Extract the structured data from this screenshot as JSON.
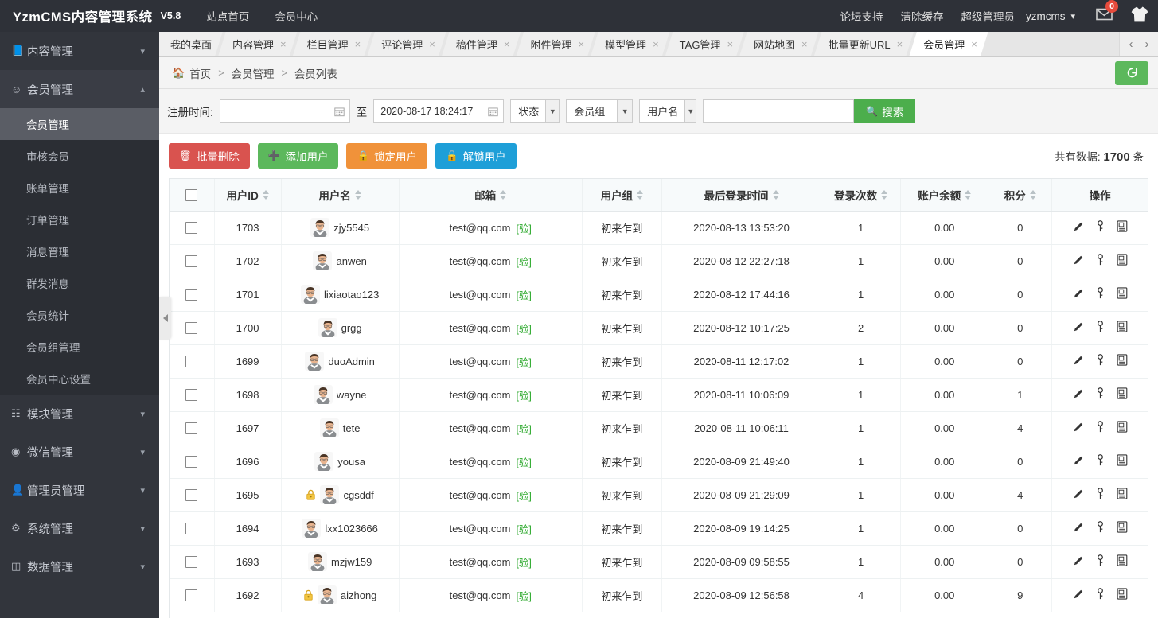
{
  "header": {
    "brand": "YzmCMS内容管理系统",
    "version": "V5.8",
    "nav": [
      {
        "label": "站点首页",
        "name": "site-home-link"
      },
      {
        "label": "会员中心",
        "name": "member-center-link"
      }
    ],
    "right_links": [
      {
        "label": "论坛支持",
        "name": "forum-support-link"
      },
      {
        "label": "清除缓存",
        "name": "clear-cache-link"
      },
      {
        "label": "超级管理员",
        "name": "super-admin-link"
      }
    ],
    "username": "yzmcms",
    "message_badge": "0"
  },
  "sidebar": {
    "groups": [
      {
        "label": "内容管理",
        "icon": "book-icon",
        "open": false,
        "items": []
      },
      {
        "label": "会员管理",
        "icon": "user-outline-icon",
        "open": true,
        "items": [
          {
            "label": "会员管理",
            "active": true
          },
          {
            "label": "审核会员",
            "active": false
          },
          {
            "label": "账单管理",
            "active": false
          },
          {
            "label": "订单管理",
            "active": false
          },
          {
            "label": "消息管理",
            "active": false
          },
          {
            "label": "群发消息",
            "active": false
          },
          {
            "label": "会员统计",
            "active": false
          },
          {
            "label": "会员组管理",
            "active": false
          },
          {
            "label": "会员中心设置",
            "active": false
          }
        ]
      },
      {
        "label": "模块管理",
        "icon": "grid-icon",
        "open": false,
        "items": []
      },
      {
        "label": "微信管理",
        "icon": "wechat-icon",
        "open": false,
        "items": []
      },
      {
        "label": "管理员管理",
        "icon": "user-solid-icon",
        "open": false,
        "items": []
      },
      {
        "label": "系统管理",
        "icon": "gear-icon",
        "open": false,
        "items": []
      },
      {
        "label": "数据管理",
        "icon": "database-icon",
        "open": false,
        "items": []
      }
    ]
  },
  "tabs": [
    {
      "label": "我的桌面",
      "closable": false,
      "active": false
    },
    {
      "label": "内容管理",
      "closable": true,
      "active": false
    },
    {
      "label": "栏目管理",
      "closable": true,
      "active": false
    },
    {
      "label": "评论管理",
      "closable": true,
      "active": false
    },
    {
      "label": "稿件管理",
      "closable": true,
      "active": false
    },
    {
      "label": "附件管理",
      "closable": true,
      "active": false
    },
    {
      "label": "模型管理",
      "closable": true,
      "active": false
    },
    {
      "label": "TAG管理",
      "closable": true,
      "active": false
    },
    {
      "label": "网站地图",
      "closable": true,
      "active": false
    },
    {
      "label": "批量更新URL",
      "closable": true,
      "active": false
    },
    {
      "label": "会员管理",
      "closable": true,
      "active": true
    }
  ],
  "breadcrumb": {
    "home": "首页",
    "level2": "会员管理",
    "level3": "会员列表",
    "sep": ">"
  },
  "filter": {
    "label": "注册时间:",
    "date_from": "",
    "date_from_placeholder": "",
    "between": "至",
    "date_to": "2020-08-17 18:24:17",
    "select_state": "状态",
    "select_group": "会员组",
    "select_field": "用户名",
    "keyword": "",
    "keyword_placeholder": "",
    "search_label": "搜索"
  },
  "toolbar": {
    "batch_delete": "批量删除",
    "add_user": "添加用户",
    "lock_user": "锁定用户",
    "unlock_user": "解锁用户",
    "total_prefix": "共有数据:",
    "total_count": "1700",
    "total_suffix": "条"
  },
  "table": {
    "columns": [
      {
        "label": "",
        "sortable": false,
        "name": "select-all"
      },
      {
        "label": "用户ID",
        "sortable": true
      },
      {
        "label": "用户名",
        "sortable": true
      },
      {
        "label": "邮箱",
        "sortable": true
      },
      {
        "label": "用户组",
        "sortable": true
      },
      {
        "label": "最后登录时间",
        "sortable": true
      },
      {
        "label": "登录次数",
        "sortable": true
      },
      {
        "label": "账户余额",
        "sortable": true
      },
      {
        "label": "积分",
        "sortable": true
      },
      {
        "label": "操作",
        "sortable": false
      }
    ],
    "verified_badge": "[验]",
    "rows": [
      {
        "id": "1703",
        "username": "zjy5545",
        "locked": false,
        "email": "test@qq.com",
        "group": "初来乍到",
        "last_login": "2020-08-13 13:53:20",
        "login_count": "1",
        "balance": "0.00",
        "points": "0"
      },
      {
        "id": "1702",
        "username": "anwen",
        "locked": false,
        "email": "test@qq.com",
        "group": "初来乍到",
        "last_login": "2020-08-12 22:27:18",
        "login_count": "1",
        "balance": "0.00",
        "points": "0"
      },
      {
        "id": "1701",
        "username": "lixiaotao123",
        "locked": false,
        "email": "test@qq.com",
        "group": "初来乍到",
        "last_login": "2020-08-12 17:44:16",
        "login_count": "1",
        "balance": "0.00",
        "points": "0"
      },
      {
        "id": "1700",
        "username": "grgg",
        "locked": false,
        "email": "test@qq.com",
        "group": "初来乍到",
        "last_login": "2020-08-12 10:17:25",
        "login_count": "2",
        "balance": "0.00",
        "points": "0"
      },
      {
        "id": "1699",
        "username": "duoAdmin",
        "locked": false,
        "email": "test@qq.com",
        "group": "初来乍到",
        "last_login": "2020-08-11 12:17:02",
        "login_count": "1",
        "balance": "0.00",
        "points": "0"
      },
      {
        "id": "1698",
        "username": "wayne",
        "locked": false,
        "email": "test@qq.com",
        "group": "初来乍到",
        "last_login": "2020-08-11 10:06:09",
        "login_count": "1",
        "balance": "0.00",
        "points": "1"
      },
      {
        "id": "1697",
        "username": "tete",
        "locked": false,
        "email": "test@qq.com",
        "group": "初来乍到",
        "last_login": "2020-08-11 10:06:11",
        "login_count": "1",
        "balance": "0.00",
        "points": "4"
      },
      {
        "id": "1696",
        "username": "yousa",
        "locked": false,
        "email": "test@qq.com",
        "group": "初来乍到",
        "last_login": "2020-08-09 21:49:40",
        "login_count": "1",
        "balance": "0.00",
        "points": "0"
      },
      {
        "id": "1695",
        "username": "cgsddf",
        "locked": true,
        "email": "test@qq.com",
        "group": "初来乍到",
        "last_login": "2020-08-09 21:29:09",
        "login_count": "1",
        "balance": "0.00",
        "points": "4"
      },
      {
        "id": "1694",
        "username": "lxx1023666",
        "locked": false,
        "email": "test@qq.com",
        "group": "初来乍到",
        "last_login": "2020-08-09 19:14:25",
        "login_count": "1",
        "balance": "0.00",
        "points": "0"
      },
      {
        "id": "1693",
        "username": "mzjw159",
        "locked": false,
        "email": "test@qq.com",
        "group": "初来乍到",
        "last_login": "2020-08-09 09:58:55",
        "login_count": "1",
        "balance": "0.00",
        "points": "0"
      },
      {
        "id": "1692",
        "username": "aizhong",
        "locked": true,
        "email": "test@qq.com",
        "group": "初来乍到",
        "last_login": "2020-08-09 12:56:58",
        "login_count": "4",
        "balance": "0.00",
        "points": "9"
      }
    ]
  },
  "colors": {
    "topbar": "#2e3138",
    "sidebar": "#32353c",
    "accent_green": "#5cb85c",
    "danger_red": "#d9534f",
    "warning_orange": "#f0923a",
    "info_blue": "#1e9fd8",
    "verified_green": "#2faa2f",
    "badge_red": "#e64b3c"
  }
}
